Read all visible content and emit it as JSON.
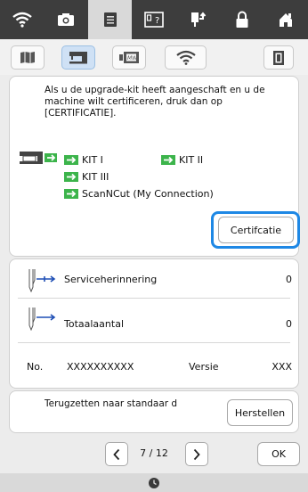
{
  "top_tabs": [
    {
      "icon": "wifi-icon"
    },
    {
      "icon": "camera-icon"
    },
    {
      "icon": "document-icon"
    },
    {
      "icon": "help-screen-icon"
    },
    {
      "icon": "needle-up-icon"
    },
    {
      "icon": "lock-icon"
    },
    {
      "icon": "home-icon"
    }
  ],
  "sub_tabs": [
    {
      "icon": "book-icon"
    },
    {
      "icon": "sewing-machine-icon"
    },
    {
      "icon": "embroidery-icon"
    },
    {
      "icon": "wifi-icon"
    },
    {
      "icon": "screen-frame-icon"
    }
  ],
  "certificate": {
    "description": "Als u de upgrade-kit heeft aangeschaft en u de machine wilt certificeren, druk dan op [CERTIFICATIE].",
    "kits": [
      "KIT I",
      "KIT II",
      "KIT III",
      "ScanNCut (My Connection)"
    ],
    "button_label": "Certifcatie"
  },
  "info": {
    "service_label": "Serviceherinnering",
    "service_value": "0",
    "total_label": "Totaalaantal",
    "total_value": "0",
    "no_label": "No.",
    "no_value": "XXXXXXXXXX",
    "version_label": "Versie",
    "version_value": "XXX"
  },
  "reset": {
    "text": "Terugzetten naar standaar d",
    "button_label": "Herstellen"
  },
  "pager": {
    "current": "7",
    "separator": "/",
    "total": "12",
    "ok_label": "OK"
  },
  "colors": {
    "highlight": "#1e88e5",
    "kit_arrow": "#3cb44b",
    "topbar": "#3d3d3d"
  }
}
